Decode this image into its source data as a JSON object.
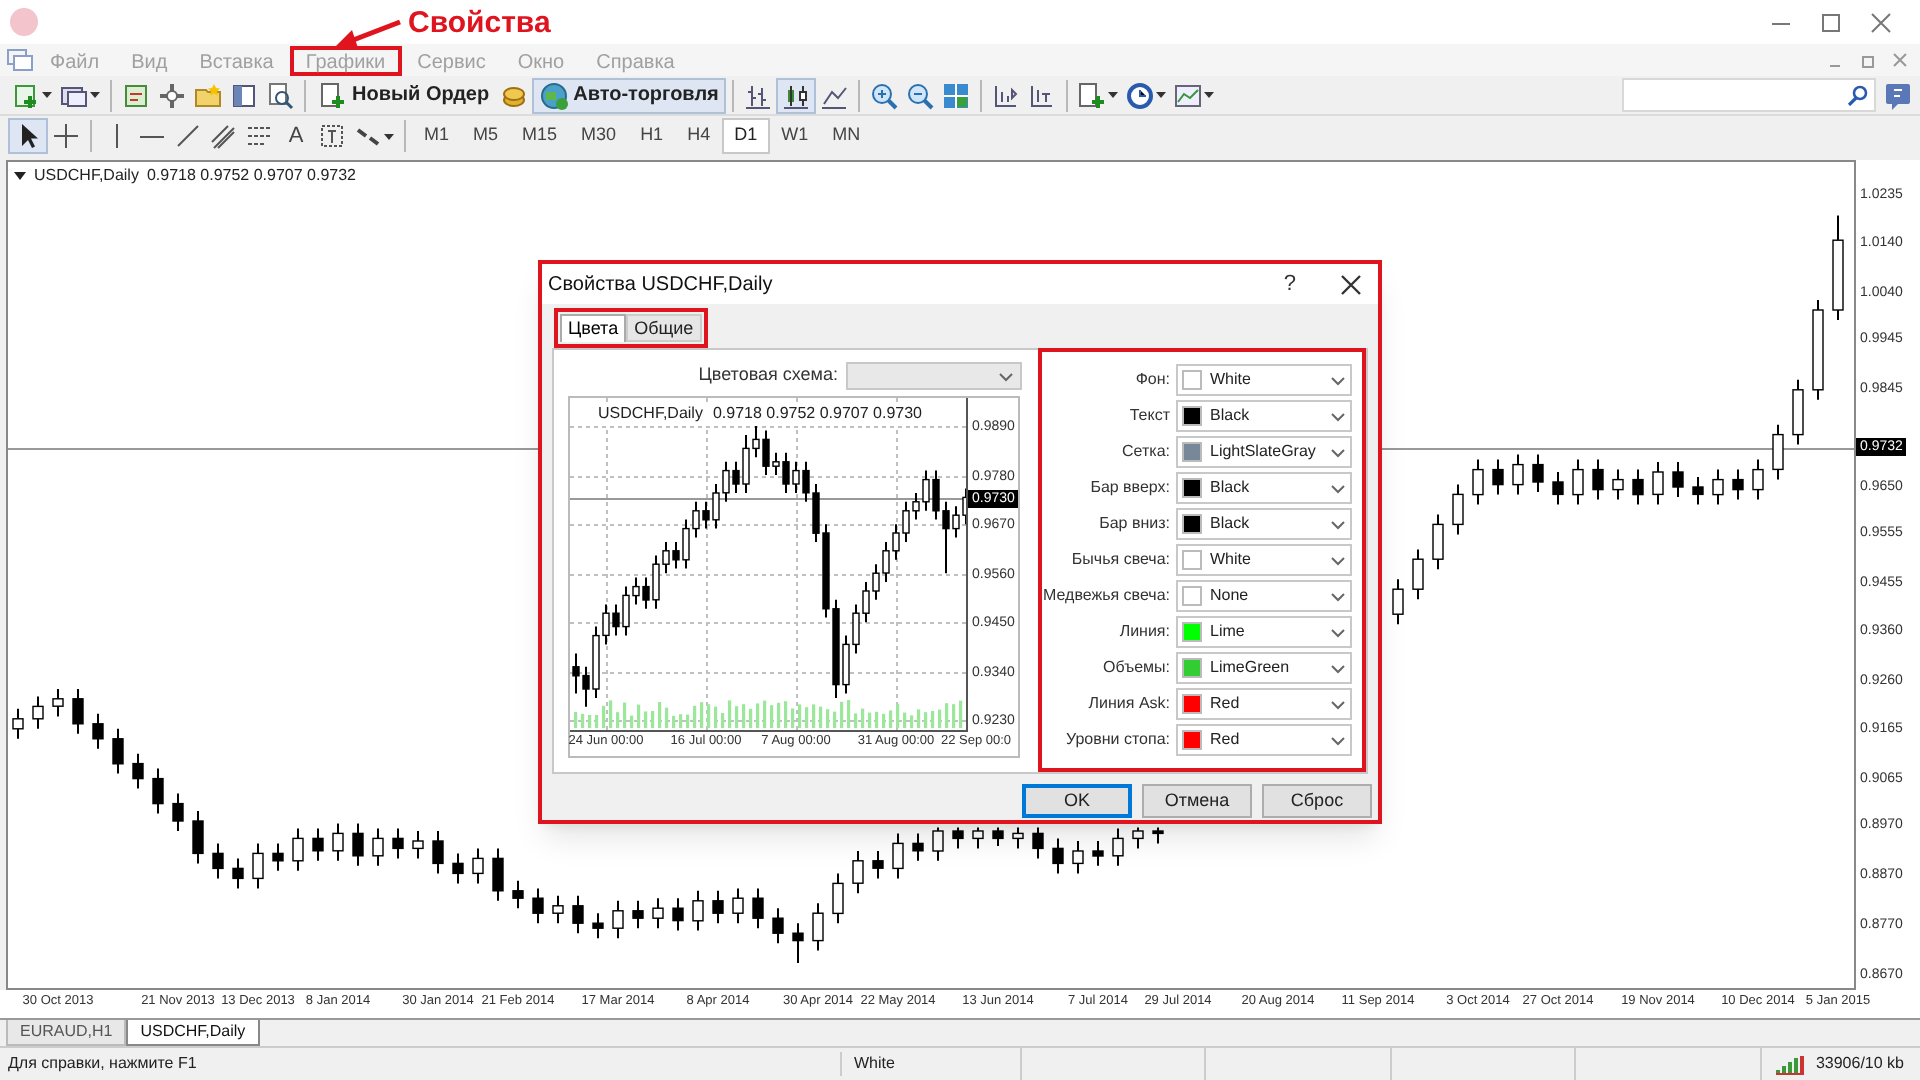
{
  "annotation": {
    "text": "Свойства"
  },
  "menu": [
    {
      "label": "Файл",
      "highlighted": false
    },
    {
      "label": "Вид",
      "highlighted": false
    },
    {
      "label": "Вставка",
      "highlighted": false
    },
    {
      "label": "Графики",
      "highlighted": true
    },
    {
      "label": "Сервис",
      "highlighted": false
    },
    {
      "label": "Окно",
      "highlighted": false
    },
    {
      "label": "Справка",
      "highlighted": false
    }
  ],
  "toolbar": {
    "new_order": "Новый Ордер",
    "auto_trading": "Авто-торговля",
    "text_tool": "A",
    "timeframes": [
      {
        "label": "M1",
        "selected": false
      },
      {
        "label": "M5",
        "selected": false
      },
      {
        "label": "M15",
        "selected": false
      },
      {
        "label": "M30",
        "selected": false
      },
      {
        "label": "H1",
        "selected": false
      },
      {
        "label": "H4",
        "selected": false
      },
      {
        "label": "D1",
        "selected": true
      },
      {
        "label": "W1",
        "selected": false
      },
      {
        "label": "MN",
        "selected": false
      }
    ]
  },
  "chart": {
    "symbol": "USDCHF,Daily",
    "ohlc": "0.9718 0.9752 0.9707 0.9732",
    "chart_data": {
      "type": "candlestick",
      "ylim": [
        0.865,
        1.0307
      ],
      "ref_lines": [
        {
          "axis": "y",
          "value": 0.9732,
          "label": "0.9732"
        }
      ],
      "categories": [
        null,
        null,
        "30 Oct 2013",
        null,
        null,
        null,
        null,
        null,
        "21 Nov 2013",
        null,
        null,
        null,
        "13 Dec 2013",
        null,
        null,
        null,
        "8 Jan 2014",
        null,
        null,
        null,
        null,
        "30 Jan 2014",
        null,
        null,
        null,
        "21 Feb 2014",
        null,
        null,
        null,
        null,
        "17 Mar 2014",
        null,
        null,
        null,
        null,
        "8 Apr 2014",
        null,
        null,
        null,
        null,
        "30 Apr 2014",
        null,
        null,
        null,
        "22 May 2014",
        null,
        null,
        null,
        null,
        "13 Jun 2014",
        null,
        null,
        null,
        null,
        "7 Jul 2014",
        null,
        null,
        null,
        "29 Jul 2014",
        null,
        null,
        null,
        null,
        "20 Aug 2014",
        null,
        null,
        null,
        null,
        "11 Sep 2014",
        null,
        null,
        null,
        null,
        "3 Oct 2014",
        null,
        null,
        null,
        "27 Oct 2014",
        null,
        null,
        null,
        null,
        "19 Nov 2014",
        null,
        null,
        null,
        null,
        "10 Dec 2014",
        null,
        null,
        null,
        "5 Jan 2015"
      ],
      "ohlc": [
        [
          0.917,
          0.921,
          0.915,
          0.919
        ],
        [
          0.919,
          0.9235,
          0.917,
          0.9215
        ],
        [
          0.9215,
          0.925,
          0.9195,
          0.923
        ],
        [
          0.923,
          0.925,
          0.916,
          0.918
        ],
        [
          0.918,
          0.92,
          0.913,
          0.915
        ],
        [
          0.915,
          0.917,
          0.908,
          0.91
        ],
        [
          0.91,
          0.912,
          0.905,
          0.907
        ],
        [
          0.907,
          0.909,
          0.9,
          0.902
        ],
        [
          0.902,
          0.904,
          0.8965,
          0.8985
        ],
        [
          0.8985,
          0.9005,
          0.89,
          0.892
        ],
        [
          0.892,
          0.894,
          0.887,
          0.889
        ],
        [
          0.889,
          0.891,
          0.885,
          0.887
        ],
        [
          0.887,
          0.894,
          0.885,
          0.892
        ],
        [
          0.892,
          0.894,
          0.8885,
          0.8905
        ],
        [
          0.8905,
          0.897,
          0.8885,
          0.895
        ],
        [
          0.895,
          0.897,
          0.8905,
          0.8925
        ],
        [
          0.8925,
          0.898,
          0.8905,
          0.896
        ],
        [
          0.896,
          0.898,
          0.8895,
          0.8915
        ],
        [
          0.8915,
          0.897,
          0.8895,
          0.895
        ],
        [
          0.895,
          0.897,
          0.891,
          0.893
        ],
        [
          0.893,
          0.8965,
          0.891,
          0.8945
        ],
        [
          0.8945,
          0.8965,
          0.888,
          0.89
        ],
        [
          0.89,
          0.892,
          0.886,
          0.888
        ],
        [
          0.888,
          0.893,
          0.886,
          0.891
        ],
        [
          0.891,
          0.893,
          0.8825,
          0.8845
        ],
        [
          0.8845,
          0.8865,
          0.881,
          0.883
        ],
        [
          0.883,
          0.885,
          0.878,
          0.88
        ],
        [
          0.88,
          0.8835,
          0.878,
          0.8815
        ],
        [
          0.8815,
          0.8835,
          0.876,
          0.878
        ],
        [
          0.878,
          0.88,
          0.875,
          0.877
        ],
        [
          0.877,
          0.8825,
          0.875,
          0.8805
        ],
        [
          0.8805,
          0.8825,
          0.877,
          0.879
        ],
        [
          0.879,
          0.883,
          0.877,
          0.881
        ],
        [
          0.881,
          0.883,
          0.8765,
          0.8785
        ],
        [
          0.8785,
          0.8845,
          0.8765,
          0.8825
        ],
        [
          0.8825,
          0.8845,
          0.878,
          0.88
        ],
        [
          0.88,
          0.885,
          0.878,
          0.883
        ],
        [
          0.883,
          0.885,
          0.877,
          0.879
        ],
        [
          0.879,
          0.881,
          0.874,
          0.876
        ],
        [
          0.876,
          0.878,
          0.87,
          0.8745
        ],
        [
          0.8745,
          0.882,
          0.8725,
          0.88
        ],
        [
          0.88,
          0.888,
          0.878,
          0.886
        ],
        [
          0.886,
          0.8925,
          0.884,
          0.8905
        ],
        [
          0.8905,
          0.8925,
          0.887,
          0.889
        ],
        [
          0.889,
          0.896,
          0.887,
          0.894
        ],
        [
          0.894,
          0.896,
          0.8905,
          0.8925
        ],
        [
          0.8925,
          0.8972,
          0.8905,
          0.8965
        ],
        [
          0.8965,
          0.8972,
          0.893,
          0.895
        ],
        [
          0.895,
          0.8972,
          0.893,
          0.8965
        ],
        [
          0.8965,
          0.8972,
          0.8935,
          0.895
        ],
        [
          0.895,
          0.8972,
          0.893,
          0.896
        ],
        [
          0.896,
          0.8972,
          0.891,
          0.893
        ],
        [
          0.893,
          0.895,
          0.888,
          0.89
        ],
        [
          0.89,
          0.8945,
          0.888,
          0.8925
        ],
        [
          0.8925,
          0.8945,
          0.8895,
          0.8915
        ],
        [
          0.8915,
          0.897,
          0.8895,
          0.895
        ],
        [
          0.895,
          0.8972,
          0.893,
          0.8965
        ],
        [
          0.8965,
          0.8972,
          0.894,
          0.896
        ],
        null,
        null,
        null,
        null,
        null,
        null,
        null,
        null,
        null,
        null,
        null,
        [
          0.94,
          0.947,
          0.938,
          0.945
        ],
        [
          0.945,
          0.953,
          0.943,
          0.951
        ],
        [
          0.951,
          0.96,
          0.949,
          0.958
        ],
        [
          0.958,
          0.966,
          0.956,
          0.964
        ],
        [
          0.964,
          0.971,
          0.962,
          0.969
        ],
        [
          0.969,
          0.971,
          0.964,
          0.966
        ],
        [
          0.966,
          0.972,
          0.964,
          0.97
        ],
        [
          0.97,
          0.972,
          0.9645,
          0.9665
        ],
        [
          0.9665,
          0.9685,
          0.962,
          0.964
        ],
        [
          0.964,
          0.971,
          0.962,
          0.969
        ],
        [
          0.969,
          0.971,
          0.963,
          0.965
        ],
        [
          0.965,
          0.969,
          0.963,
          0.967
        ],
        [
          0.967,
          0.969,
          0.962,
          0.964
        ],
        [
          0.964,
          0.9705,
          0.962,
          0.9685
        ],
        [
          0.9685,
          0.9705,
          0.9635,
          0.9655
        ],
        [
          0.9655,
          0.9675,
          0.962,
          0.964
        ],
        [
          0.964,
          0.969,
          0.962,
          0.967
        ],
        [
          0.967,
          0.969,
          0.963,
          0.965
        ],
        [
          0.965,
          0.971,
          0.963,
          0.969
        ],
        [
          0.969,
          0.978,
          0.967,
          0.976
        ],
        [
          0.976,
          0.987,
          0.974,
          0.985
        ],
        [
          0.985,
          1.003,
          0.983,
          1.001
        ],
        [
          1.001,
          1.02,
          0.999,
          1.015
        ]
      ],
      "yticks": [
        {
          "value": 1.0235,
          "label": "1.0235"
        },
        {
          "value": 1.014,
          "label": "1.0140"
        },
        {
          "value": 1.004,
          "label": "1.0040"
        },
        {
          "value": 0.9945,
          "label": "0.9945"
        },
        {
          "value": 0.9845,
          "label": "0.9845"
        },
        {
          "value": 0.965,
          "label": "0.9650"
        },
        {
          "value": 0.9555,
          "label": "0.9555"
        },
        {
          "value": 0.9455,
          "label": "0.9455"
        },
        {
          "value": 0.936,
          "label": "0.9360"
        },
        {
          "value": 0.926,
          "label": "0.9260"
        },
        {
          "value": 0.9165,
          "label": "0.9165"
        },
        {
          "value": 0.9065,
          "label": "0.9065"
        },
        {
          "value": 0.897,
          "label": "0.8970"
        },
        {
          "value": 0.887,
          "label": "0.8870"
        },
        {
          "value": 0.877,
          "label": "0.8770"
        },
        {
          "value": 0.867,
          "label": "0.8670"
        }
      ]
    }
  },
  "chart_tabs": [
    {
      "label": "EURAUD,H1",
      "selected": false
    },
    {
      "label": "USDCHF,Daily",
      "selected": true
    }
  ],
  "status_bar": {
    "help": "Для справки, нажмите F1",
    "scheme": "White",
    "traffic": "33906/10 kb"
  },
  "dialog": {
    "title": "Свойства USDCHF,Daily",
    "help": "?",
    "tabs": [
      {
        "label": "Цвета",
        "selected": true
      },
      {
        "label": "Общие",
        "selected": false
      }
    ],
    "color_scheme": {
      "label": "Цветовая схема:"
    },
    "preview": {
      "symbol": "USDCHF,Daily",
      "ohlc": "0.9718 0.9752 0.9707 0.9730",
      "chart_data": {
        "type": "candlestick",
        "ylim": [
          0.9208,
          0.9953
        ],
        "grid": true,
        "ref_lines": [
          {
            "axis": "y",
            "value": 0.973,
            "label": "0.9730"
          }
        ],
        "categories": [
          null,
          null,
          null,
          "24 Jun 00:00",
          null,
          null,
          null,
          null,
          null,
          null,
          null,
          null,
          null,
          "16 Jul 00:00",
          null,
          null,
          null,
          null,
          null,
          null,
          null,
          null,
          "7 Aug 00:00",
          null,
          null,
          null,
          null,
          null,
          null,
          null,
          null,
          null,
          "31 Aug 00:00",
          null,
          null,
          null,
          null,
          null,
          null,
          null,
          "22 Sep 00:0"
        ],
        "ohlc": [
          [
            0.935,
            0.938,
            0.929,
            0.933
          ],
          [
            0.933,
            0.935,
            0.926,
            0.93
          ],
          [
            0.93,
            0.944,
            0.928,
            0.942
          ],
          [
            0.942,
            0.949,
            0.94,
            0.947
          ],
          [
            0.947,
            0.949,
            0.942,
            0.944
          ],
          [
            0.944,
            0.953,
            0.942,
            0.951
          ],
          [
            0.951,
            0.955,
            0.949,
            0.953
          ],
          [
            0.953,
            0.955,
            0.948,
            0.95
          ],
          [
            0.95,
            0.96,
            0.948,
            0.958
          ],
          [
            0.958,
            0.963,
            0.956,
            0.961
          ],
          [
            0.961,
            0.963,
            0.957,
            0.959
          ],
          [
            0.959,
            0.968,
            0.957,
            0.966
          ],
          [
            0.966,
            0.972,
            0.964,
            0.97
          ],
          [
            0.97,
            0.972,
            0.966,
            0.968
          ],
          [
            0.968,
            0.976,
            0.966,
            0.974
          ],
          [
            0.974,
            0.981,
            0.972,
            0.979
          ],
          [
            0.979,
            0.981,
            0.974,
            0.976
          ],
          [
            0.976,
            0.987,
            0.974,
            0.984
          ],
          [
            0.984,
            0.99,
            0.982,
            0.986
          ],
          [
            0.986,
            0.988,
            0.978,
            0.98
          ],
          [
            0.98,
            0.983,
            0.978,
            0.981
          ],
          [
            0.981,
            0.983,
            0.974,
            0.976
          ],
          [
            0.976,
            0.981,
            0.974,
            0.979
          ],
          [
            0.979,
            0.981,
            0.972,
            0.974
          ],
          [
            0.974,
            0.976,
            0.963,
            0.965
          ],
          [
            0.965,
            0.967,
            0.946,
            0.948
          ],
          [
            0.948,
            0.95,
            0.928,
            0.931
          ],
          [
            0.931,
            0.942,
            0.929,
            0.94
          ],
          [
            0.94,
            0.949,
            0.938,
            0.947
          ],
          [
            0.947,
            0.954,
            0.945,
            0.952
          ],
          [
            0.952,
            0.958,
            0.95,
            0.956
          ],
          [
            0.956,
            0.963,
            0.954,
            0.961
          ],
          [
            0.961,
            0.967,
            0.959,
            0.965
          ],
          [
            0.965,
            0.972,
            0.963,
            0.97
          ],
          [
            0.97,
            0.974,
            0.968,
            0.972
          ],
          [
            0.972,
            0.979,
            0.97,
            0.977
          ],
          [
            0.977,
            0.979,
            0.968,
            0.97
          ],
          [
            0.97,
            0.972,
            0.956,
            0.966
          ],
          [
            0.966,
            0.971,
            0.964,
            0.969
          ],
          [
            0.969,
            0.975,
            0.967,
            0.973
          ],
          null
        ],
        "yticks": [
          {
            "value": 0.989,
            "label": "0.9890"
          },
          {
            "value": 0.978,
            "label": "0.9780"
          },
          {
            "value": 0.967,
            "label": "0.9670"
          },
          {
            "value": 0.956,
            "label": "0.9560"
          },
          {
            "value": 0.945,
            "label": "0.9450"
          },
          {
            "value": 0.934,
            "label": "0.9340"
          },
          {
            "value": 0.923,
            "label": "0.9230"
          }
        ]
      }
    },
    "colors": [
      {
        "label": "Фон:",
        "value": "White",
        "color": "#ffffff"
      },
      {
        "label": "Текст",
        "value": "Black",
        "color": "#000000"
      },
      {
        "label": "Сетка:",
        "value": "LightSlateGray",
        "color": "#778899"
      },
      {
        "label": "Бар вверх:",
        "value": "Black",
        "color": "#000000"
      },
      {
        "label": "Бар вниз:",
        "value": "Black",
        "color": "#000000"
      },
      {
        "label": "Бычья свеча:",
        "value": "White",
        "color": "#ffffff"
      },
      {
        "label": "Медвежья свеча:",
        "value": "None",
        "color": "#ffffff"
      },
      {
        "label": "Линия:",
        "value": "Lime",
        "color": "#00ff00"
      },
      {
        "label": "Объемы:",
        "value": "LimeGreen",
        "color": "#32cd32"
      },
      {
        "label": "Линия Ask:",
        "value": "Red",
        "color": "#ff0000"
      },
      {
        "label": "Уровни стопа:",
        "value": "Red",
        "color": "#ff0000"
      }
    ],
    "buttons": [
      {
        "label": "OK",
        "default": true
      },
      {
        "label": "Отмена",
        "default": false
      },
      {
        "label": "Сброс",
        "default": false
      }
    ]
  }
}
